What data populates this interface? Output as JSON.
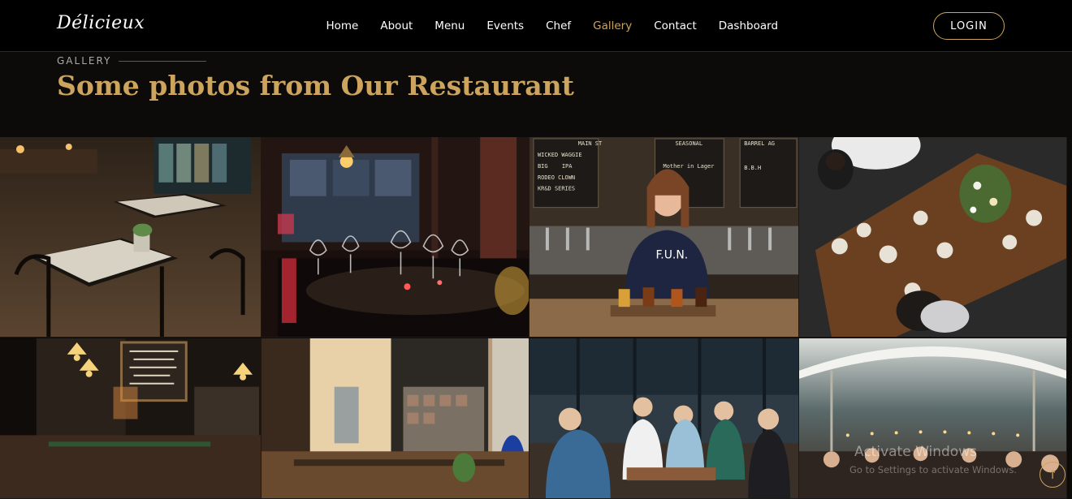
{
  "brand": {
    "logo_text": "Délicieux",
    "accent_color": "#cda45e"
  },
  "nav": {
    "items": [
      {
        "label": "Home"
      },
      {
        "label": "About"
      },
      {
        "label": "Menu"
      },
      {
        "label": "Events"
      },
      {
        "label": "Chef"
      },
      {
        "label": "Gallery",
        "active": true
      },
      {
        "label": "Contact"
      },
      {
        "label": "Dashboard"
      }
    ],
    "login_label": "LOGIN"
  },
  "section": {
    "label": "GALLERY",
    "title": "Some photos from Our Restaurant"
  },
  "gallery": {
    "photos": [
      {
        "name": "restaurant-interior-tables"
      },
      {
        "name": "wine-glasses-table"
      },
      {
        "name": "bartender-beer-flight"
      },
      {
        "name": "overhead-dining-table"
      },
      {
        "name": "bistro-bar-menu-board"
      },
      {
        "name": "cafe-counter-interior"
      },
      {
        "name": "friends-outdoor-patio"
      },
      {
        "name": "tent-dinner-party-toast"
      }
    ],
    "photo_text": {
      "menu_board": [
        "MAIN ST",
        "SEASONAL",
        "BARREL AG",
        "WICKED WAGGIE",
        "BIG",
        "IPA",
        "RODEO CLOWN",
        "KR&D SERIES",
        "Mother in Lager",
        "B.B.H"
      ],
      "shirt": "F.U.N."
    }
  },
  "system": {
    "watermark_title": "Activate Windows",
    "watermark_sub": "Go to Settings to activate Windows.",
    "scroll_top_icon": "arrow-up-icon"
  }
}
